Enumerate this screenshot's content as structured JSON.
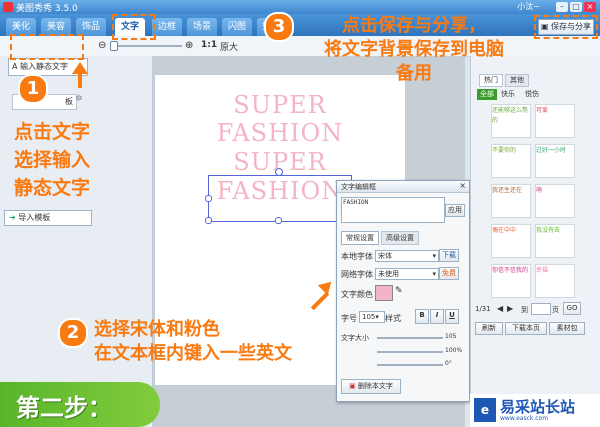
{
  "window": {
    "title": "美图秀秀 3.5.0",
    "user": "小汰~"
  },
  "tabs": [
    "美化",
    "美容",
    "饰品",
    "文字",
    "边框",
    "场景",
    "闪图",
    "娃"
  ],
  "toolbar": {
    "ratio_label": "1:1",
    "zoom_label": "原大",
    "save_share": "保存与分享"
  },
  "left_panel": {
    "input_text_button": "输入静态文字",
    "template_tab": "板",
    "import_template": "导入模板"
  },
  "canvas": {
    "lines": [
      "SUPER",
      "FASHION",
      "SUPER",
      "FASHION"
    ]
  },
  "dialog": {
    "title": "文字编辑框",
    "text_value": "FASHION",
    "apply": "应用",
    "tab_basic": "常规设置",
    "tab_advanced": "高级设置",
    "local_font_label": "本地字体",
    "local_font_value": "宋体",
    "download": "下载",
    "web_font_label": "网络字体",
    "web_font_value": "未使用",
    "free": "免费",
    "color_label": "文字颜色",
    "color_value": "#f4b4c7",
    "size_label": "字号",
    "size_value": "105",
    "style_label": "样式",
    "bold": "B",
    "italic": "I",
    "underline": "U",
    "text_size_label": "文字大小",
    "text_size_value": "105",
    "opacity_value": "100%",
    "angle_value": "0°",
    "delete_text": "删除本文字"
  },
  "right_panel": {
    "tabs": [
      "热门",
      "其他"
    ],
    "subtabs": [
      "全部",
      "快乐",
      "悦伤"
    ],
    "page_text": "1/31",
    "to_label": "到",
    "page_suffix": "页",
    "go": "GO",
    "refresh": "刷新",
    "download_page": "下载本页",
    "material_pack": "素材包",
    "stickers": [
      "还能够这么熬的",
      "可爱",
      "不要你的",
      "过好一小时",
      "我还生还在",
      "萌",
      "偶在中中",
      "我没有去",
      "你信不信我的",
      "幸福",
      "",
      ""
    ]
  },
  "annotations": {
    "step1_num": "1",
    "step1_lines": [
      "点击文字",
      "选择输入",
      "静态文字"
    ],
    "step2_num": "2",
    "step2_lines": [
      "选择宋体和粉色",
      "在文本框内键入一些英文"
    ],
    "step3_num": "3",
    "step3_lines": [
      "点击保存与分享，",
      "将文字背景保存到电脑",
      "备用"
    ],
    "step_banner": "第二步：",
    "accent_color": "#f97a10"
  },
  "watermark": {
    "name": "易采站长站",
    "sub": "www.easck.com"
  }
}
